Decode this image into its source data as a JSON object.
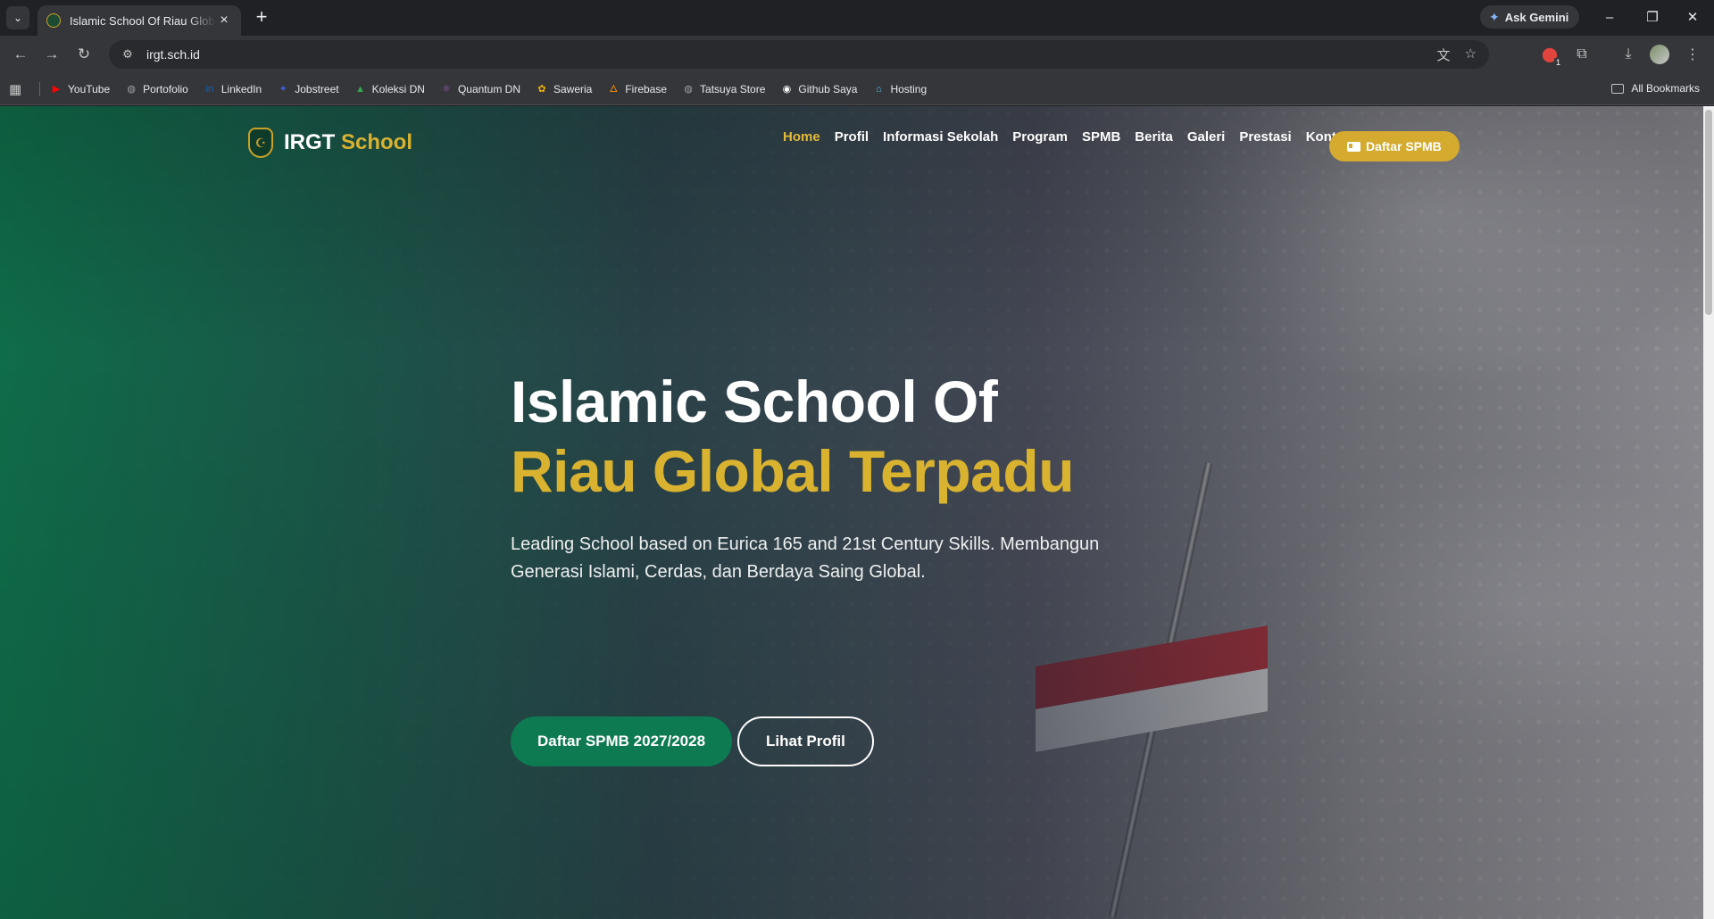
{
  "browser": {
    "tab_title": "Islamic School Of Riau Global Terpadu",
    "url": "irgt.sch.id",
    "gemini_label": "Ask Gemini",
    "bookmarks": [
      {
        "label": "YouTube",
        "icon": "youtube-icon",
        "color": "#ff0000"
      },
      {
        "label": "Portofolio",
        "icon": "globe-icon",
        "color": "#9aa0a6"
      },
      {
        "label": "LinkedIn",
        "icon": "linkedin-icon",
        "color": "#0a66c2"
      },
      {
        "label": "Jobstreet",
        "icon": "jobstreet-icon",
        "color": "#3b5bdb"
      },
      {
        "label": "Koleksi DN",
        "icon": "drive-icon",
        "color": "#34a853"
      },
      {
        "label": "Quantum DN",
        "icon": "quantum-icon",
        "color": "#9b59b6"
      },
      {
        "label": "Saweria",
        "icon": "saweria-icon",
        "color": "#f4b400"
      },
      {
        "label": "Firebase",
        "icon": "firebase-icon",
        "color": "#ff8f00"
      },
      {
        "label": "Tatsuya Store",
        "icon": "globe-icon",
        "color": "#9aa0a6"
      },
      {
        "label": "Github Saya",
        "icon": "github-icon",
        "color": "#ffffff"
      },
      {
        "label": "Hosting",
        "icon": "hosting-icon",
        "color": "#4fc3f7"
      }
    ],
    "all_bookmarks": "All Bookmarks"
  },
  "site": {
    "logo": {
      "part1": "IRGT",
      "part2": "School"
    },
    "menu": [
      {
        "label": "Home",
        "active": true
      },
      {
        "label": "Profil"
      },
      {
        "label": "Informasi Sekolah"
      },
      {
        "label": "Program"
      },
      {
        "label": "SPMB"
      },
      {
        "label": "Berita"
      },
      {
        "label": "Galeri"
      },
      {
        "label": "Prestasi"
      },
      {
        "label": "Kontak"
      }
    ],
    "cta_label": "Daftar SPMB"
  },
  "hero": {
    "title_line1": "Islamic School Of",
    "title_line2": "Riau Global Terpadu",
    "subtitle": "Leading School based on Eurica 165 and 21st Century Skills. Membangun Generasi Islami, Cerdas, dan Berdaya Saing Global.",
    "primary_button": "Daftar SPMB 2027/2028",
    "secondary_button": "Lihat Profil"
  },
  "colors": {
    "brand_green": "#0d7a52",
    "brand_gold": "#d9b230",
    "active_menu": "#e3b93a"
  }
}
